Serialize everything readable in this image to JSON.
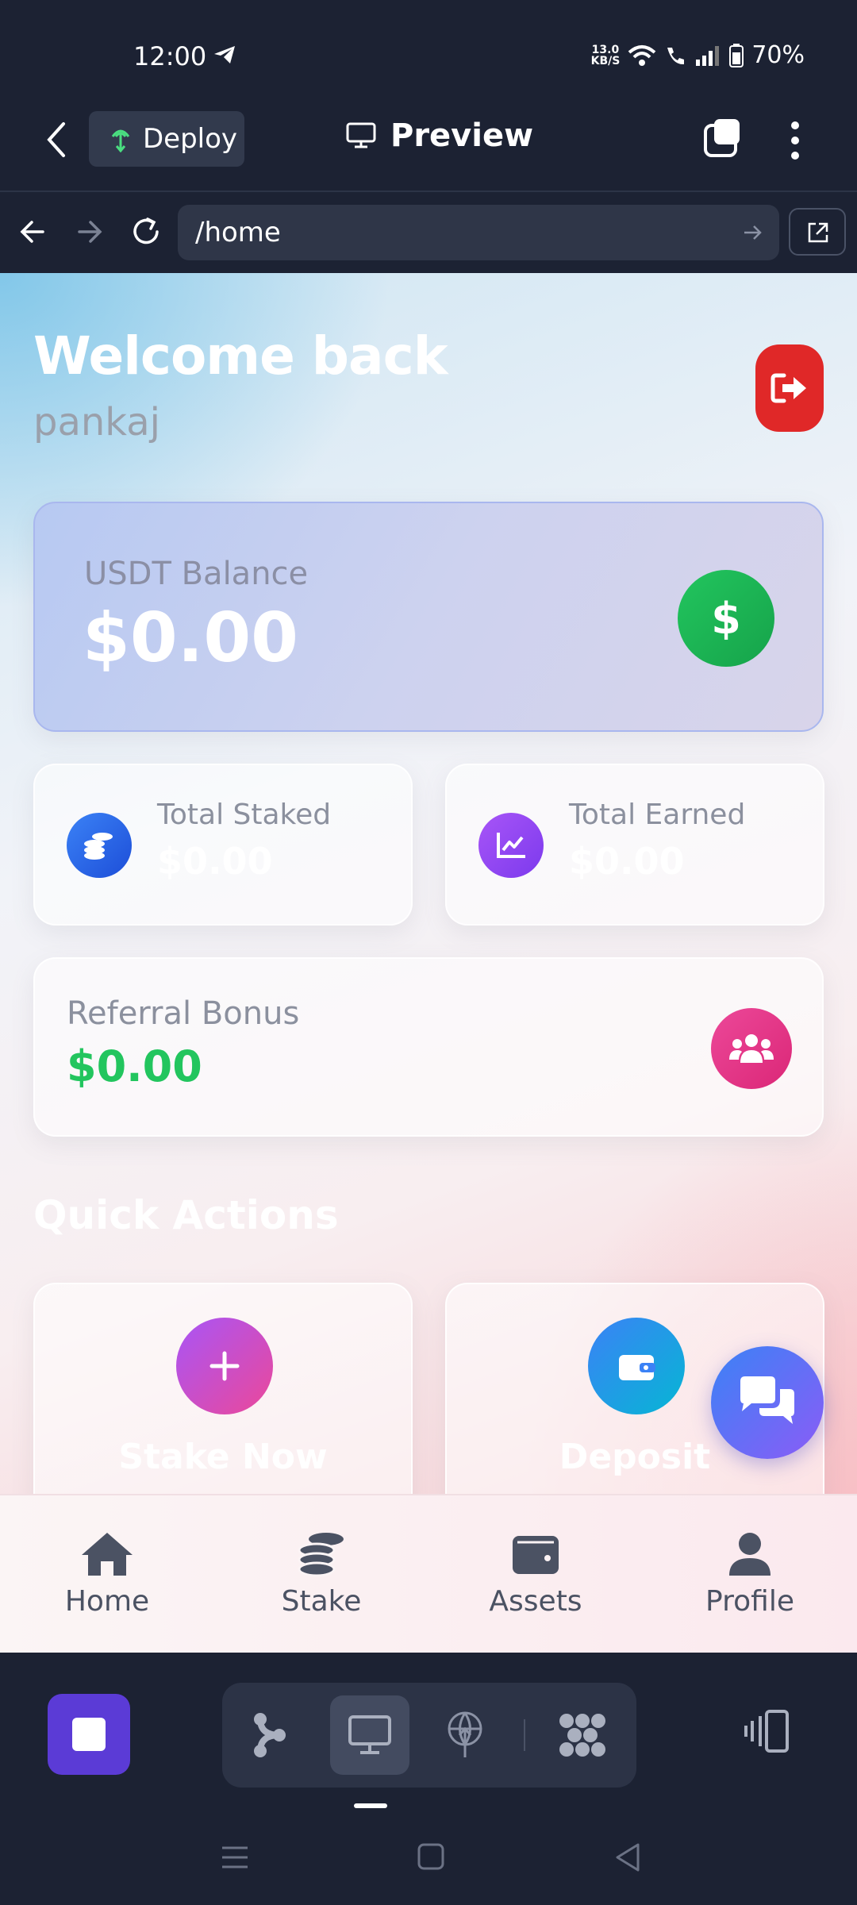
{
  "status_bar": {
    "time": "12:00",
    "net_speed_value": "13.0",
    "net_speed_unit": "KB/S",
    "battery": "70%"
  },
  "app_header": {
    "deploy_label": "Deploy",
    "preview_label": "Preview"
  },
  "url_bar": {
    "url": "/home"
  },
  "page": {
    "welcome": "Welcome back",
    "username": "pankaj",
    "balance": {
      "label": "USDT Balance",
      "value": "$0.00",
      "icon": "dollar-icon"
    },
    "total_staked": {
      "label": "Total Staked",
      "value": "$0.00",
      "icon": "coins-icon"
    },
    "total_earned": {
      "label": "Total Earned",
      "value": "$0.00",
      "icon": "chart-line-icon"
    },
    "referral": {
      "label": "Referral Bonus",
      "value": "$0.00",
      "icon": "users-icon"
    },
    "quick_actions_title": "Quick Actions",
    "quick_actions": [
      {
        "label": "Stake Now",
        "icon": "plus-icon"
      },
      {
        "label": "Deposit",
        "icon": "wallet-icon"
      }
    ]
  },
  "bottom_nav": {
    "items": [
      {
        "label": "Home",
        "icon": "home-icon"
      },
      {
        "label": "Stake",
        "icon": "coins-icon"
      },
      {
        "label": "Assets",
        "icon": "wallet-icon"
      },
      {
        "label": "Profile",
        "icon": "user-icon"
      }
    ]
  },
  "colors": {
    "accent_green": "#22c55e",
    "logout_red": "#e02828",
    "toolbar_purple": "#5b3bd6"
  }
}
